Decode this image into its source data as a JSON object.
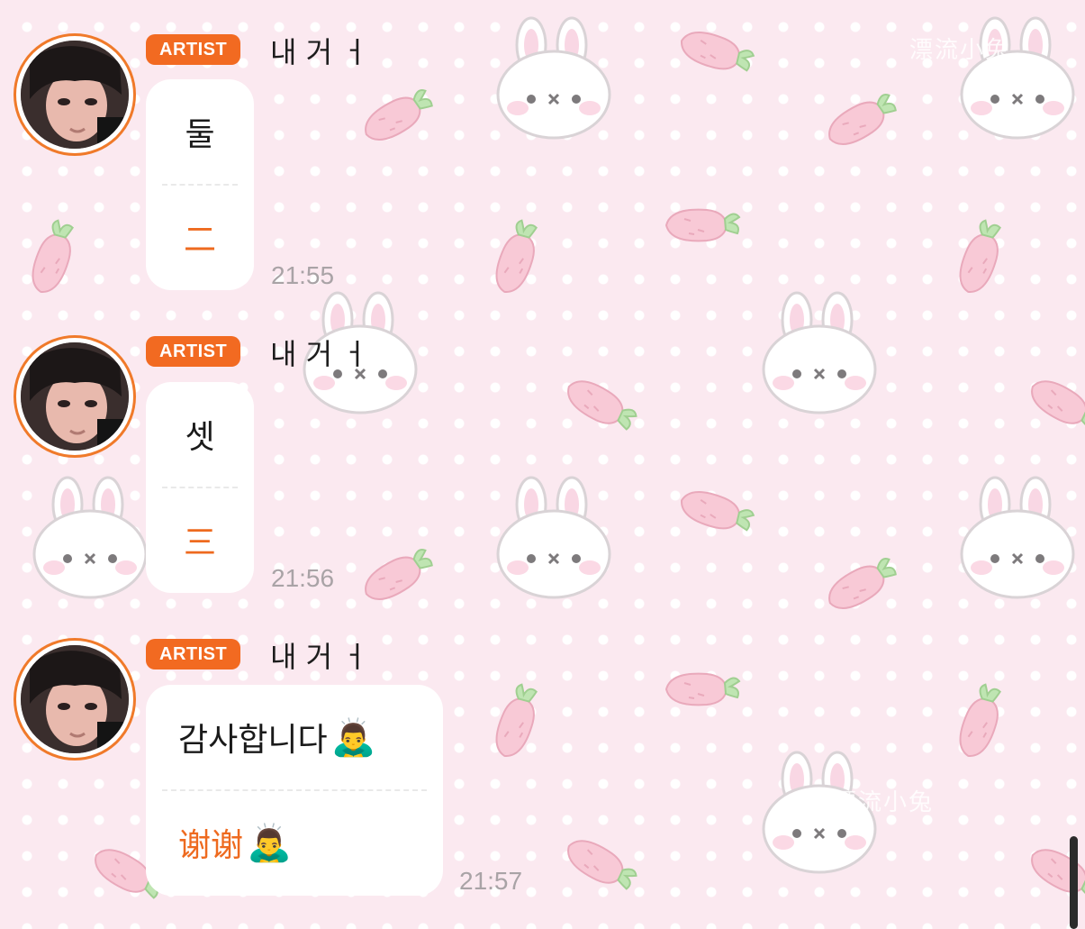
{
  "watermark": "漂流小兔",
  "messages": [
    {
      "badge": "ARTIST",
      "sender": "내 거 ㅓ",
      "original": "둘",
      "translation": "二",
      "time": "21:55"
    },
    {
      "badge": "ARTIST",
      "sender": "내 거 ㅓ",
      "original": "셋",
      "translation": "三",
      "time": "21:56"
    },
    {
      "badge": "ARTIST",
      "sender": "내 거 ㅓ",
      "original": "감사합니다",
      "original_emoji": "🙇‍♂️",
      "translation": "谢谢",
      "translation_emoji": "🙇‍♂️",
      "time": "21:57"
    }
  ],
  "icons": {
    "wallpaper": [
      "bunny-icon",
      "carrot-icon"
    ]
  },
  "colors": {
    "accent": "#f26a21",
    "background": "#fbe9f0",
    "bubble": "#ffffff",
    "time": "#a9a3a6"
  }
}
